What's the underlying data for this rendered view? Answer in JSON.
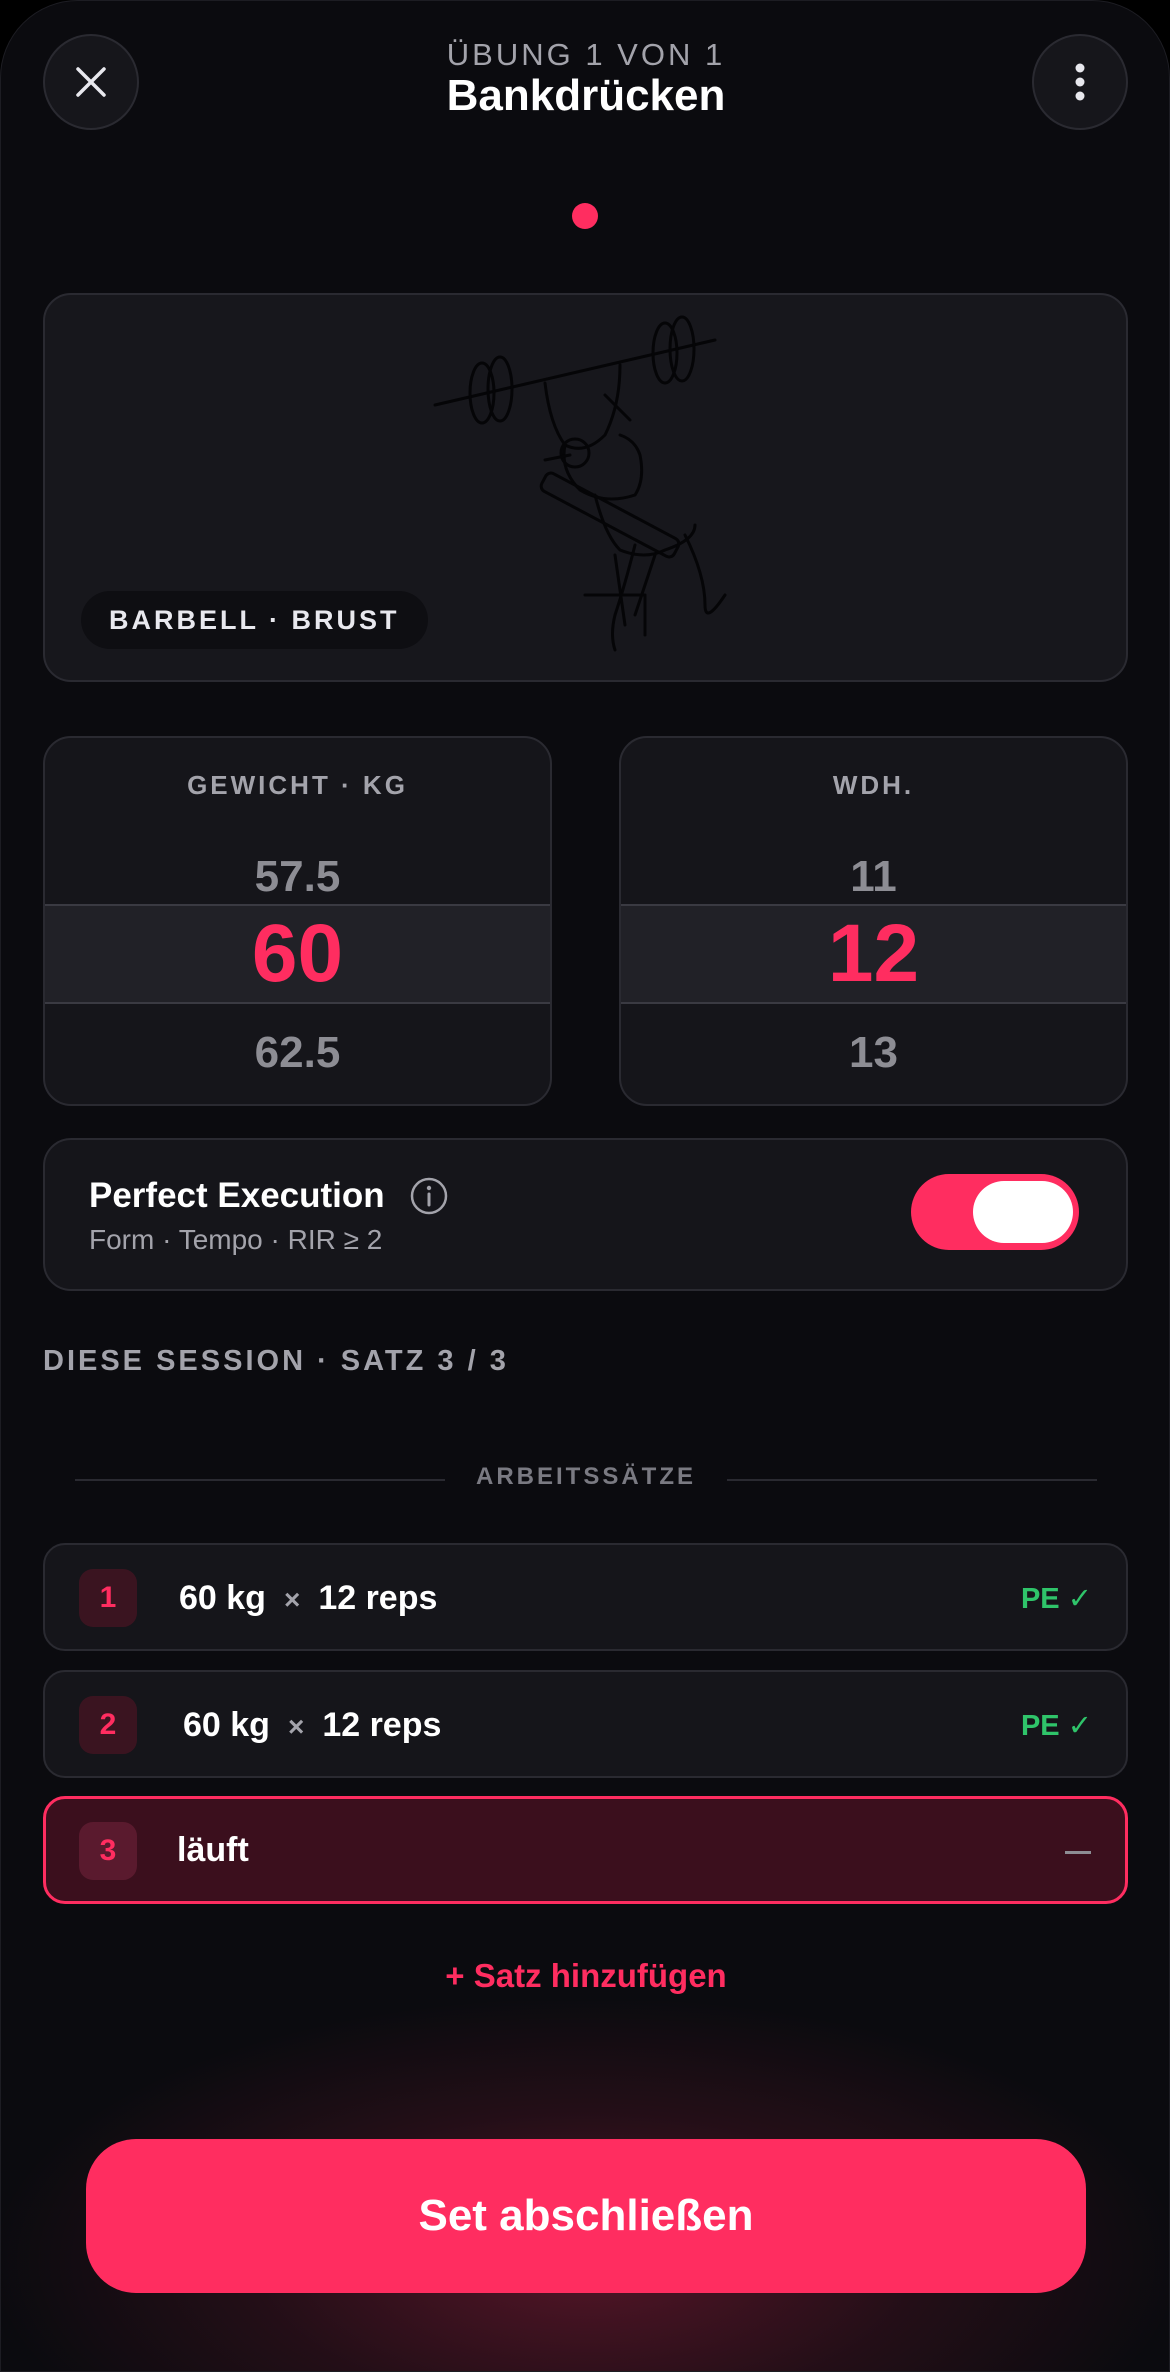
{
  "header": {
    "subtitle": "ÜBUNG 1 VON 1",
    "title": "Bankdrücken",
    "close_icon": "close-icon",
    "more_icon": "more-vertical-icon"
  },
  "pager": {
    "active_index": 0,
    "count": 1
  },
  "hero": {
    "badge": "BARBELL · BRUST",
    "illustration": "bench-press-illustration"
  },
  "weight_picker": {
    "label": "GEWICHT · KG",
    "prev": "57.5",
    "selected": "60",
    "next": "62.5"
  },
  "reps_picker": {
    "label": "WDH.",
    "prev": "11",
    "selected": "12",
    "next": "13"
  },
  "perfect_execution": {
    "title": "Perfect Execution",
    "subtitle": "Form · Tempo · RIR ≥ 2",
    "enabled": true,
    "info_icon": "info-icon"
  },
  "session": {
    "heading": "DIESE SESSION · SATZ 3 / 3",
    "divider_label": "ARBEITSSÄTZE",
    "sets": [
      {
        "num": "1",
        "weight": "60 kg",
        "times": "×",
        "reps": "12 reps",
        "status": "PE ✓"
      },
      {
        "num": "2",
        "weight": "60 kg",
        "times": "×",
        "reps": "12 reps",
        "status": "PE ✓"
      },
      {
        "num": "3",
        "label": "läuft",
        "status": "—"
      }
    ],
    "add_set": "+ Satz hinzufügen"
  },
  "cta": {
    "label": "Set abschließen"
  },
  "colors": {
    "accent": "#ff2d60",
    "success": "#2fc46a",
    "background": "#0b0b0f",
    "card": "#15151a"
  }
}
